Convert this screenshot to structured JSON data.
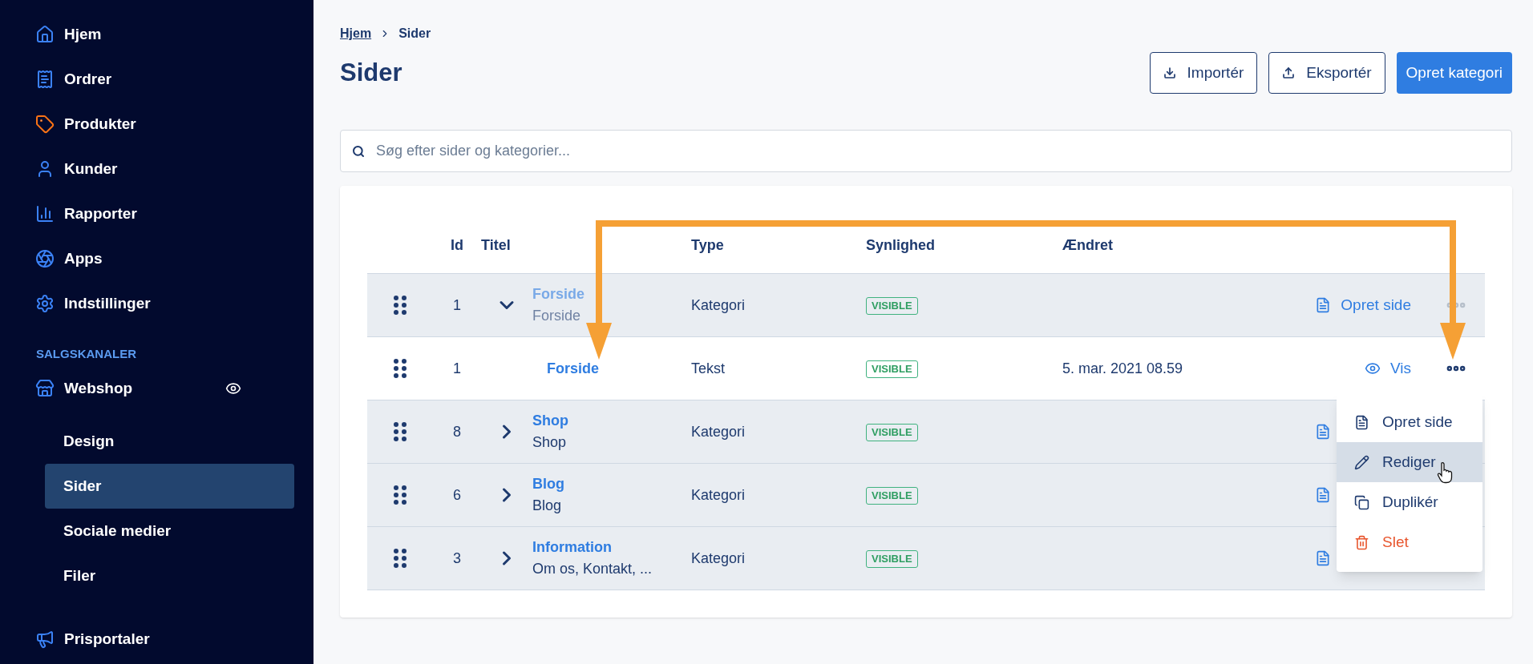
{
  "sidebar": {
    "nav": [
      {
        "label": "Hjem"
      },
      {
        "label": "Ordrer"
      },
      {
        "label": "Produkter"
      },
      {
        "label": "Kunder"
      },
      {
        "label": "Rapporter"
      },
      {
        "label": "Apps"
      },
      {
        "label": "Indstillinger"
      }
    ],
    "section": "SALGSKANALER",
    "channel": {
      "label": "Webshop",
      "visible": true,
      "children": [
        {
          "label": "Design",
          "selected": false
        },
        {
          "label": "Sider",
          "selected": true
        },
        {
          "label": "Sociale medier",
          "selected": false
        },
        {
          "label": "Filer",
          "selected": false
        }
      ]
    },
    "bottom": [
      {
        "label": "Prisportaler"
      }
    ]
  },
  "breadcrumb": [
    {
      "label": "Hjem",
      "kind": "link"
    },
    {
      "label": "Sider",
      "kind": "current"
    }
  ],
  "title": "Sider",
  "buttons": [
    {
      "label": "Importér",
      "kind": "import"
    },
    {
      "label": "Eksportér",
      "kind": "export"
    },
    {
      "label": "Opret kategori",
      "kind": "primary"
    }
  ],
  "search": {
    "placeholder": "Søg efter sider og kategorier..."
  },
  "table": {
    "columns": [
      "Id",
      "Titel",
      "Type",
      "Synlighed",
      "Ændret"
    ],
    "rows": [
      {
        "id": "1",
        "title": "Forside",
        "subtitle": "Forside",
        "type": "Kategori",
        "visibility": "VISIBLE",
        "dimmed": true,
        "expanded": true,
        "menu_button": true,
        "action": {
          "kind": "create",
          "label": "Opret side"
        },
        "children": [
          {
            "id": "1",
            "title": "Forside",
            "type": "Tekst",
            "visibility": "VISIBLE",
            "changed": "5. mar. 2021 08.59",
            "dimmed": false,
            "menu_button": true,
            "action": {
              "kind": "view",
              "label": "Vis"
            }
          }
        ]
      },
      {
        "id": "8",
        "title": "Shop",
        "subtitle": "Shop",
        "type": "Kategori",
        "visibility": "VISIBLE",
        "dimmed": false,
        "menu_button": false,
        "expanded": false,
        "action": {
          "kind": "create"
        }
      },
      {
        "id": "6",
        "title": "Blog",
        "subtitle": "Blog",
        "type": "Kategori",
        "visibility": "VISIBLE",
        "dimmed": false,
        "menu_button": false,
        "expanded": false,
        "action": {
          "kind": "create"
        }
      },
      {
        "id": "3",
        "title": "Information",
        "subtitle": "Om os, Kontakt, ...",
        "type": "Kategori",
        "visibility": "VISIBLE",
        "dimmed": false,
        "menu_button": false,
        "expanded": false,
        "action": {
          "kind": "create"
        }
      }
    ]
  },
  "menu": {
    "items": [
      {
        "label": "Opret side",
        "kind": "create",
        "selected": false
      },
      {
        "label": "Rediger",
        "kind": "edit",
        "selected": true
      },
      {
        "label": "Duplikér",
        "kind": "duplicate",
        "selected": false
      },
      {
        "label": "Slet",
        "kind": "delete",
        "selected": false
      }
    ]
  }
}
